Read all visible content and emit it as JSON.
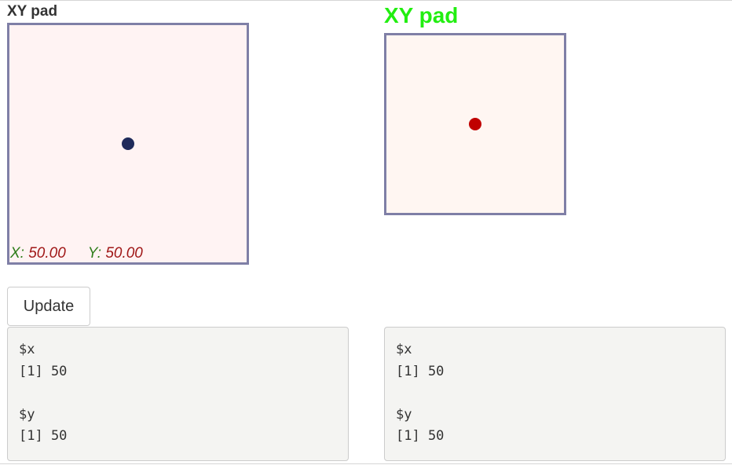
{
  "left_pad": {
    "title": "XY pad",
    "x_label": "X:",
    "x_value": "50.00",
    "y_label": "Y:",
    "y_value": "50.00",
    "x": 50,
    "y": 50,
    "dot_color": "#1f2a5a"
  },
  "right_pad": {
    "title": "XY pad",
    "title_color": "#22ee11",
    "x": 50,
    "y": 50,
    "dot_color": "#c00000"
  },
  "update_button": {
    "label": "Update"
  },
  "output_left": {
    "lines": [
      "$x",
      "[1] 50",
      "",
      "$y",
      "[1] 50"
    ]
  },
  "output_right": {
    "lines": [
      "$x",
      "[1] 50",
      "",
      "$y",
      "[1] 50"
    ]
  }
}
